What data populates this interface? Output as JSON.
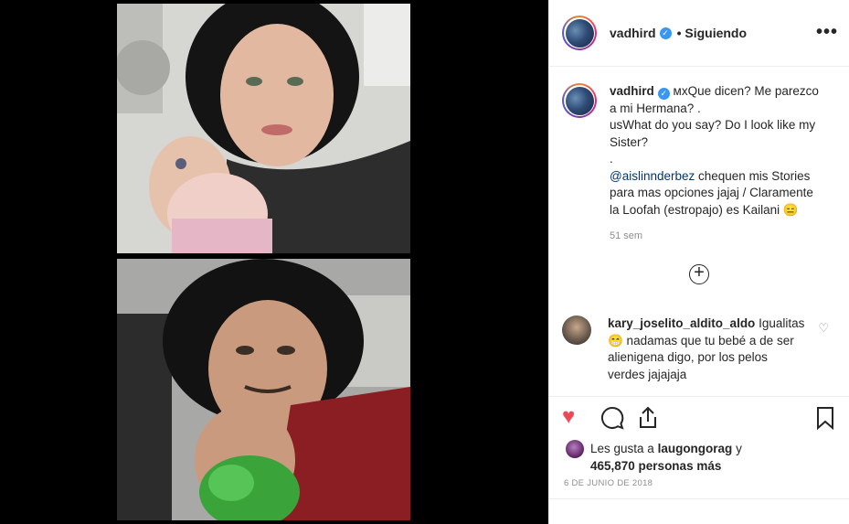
{
  "post": {
    "username": "vadhird",
    "follow_status": "Siguiendo",
    "more_label": "•••",
    "verified_glyph": "✓"
  },
  "caption": {
    "username": "vadhird",
    "lines": [
      "ᴍxQue dicen? Me parezco a mi Hermana? .",
      "usWhat do you say? Do I look like my Sister?",
      "."
    ],
    "mention": "@aislinnderbez",
    "rest": " chequen mis Stories para mas opciones jajaj / Claramente la Loofah (estropajo) es Kailani 😑",
    "time": "51 sem"
  },
  "add_comment_label": "+",
  "comment": {
    "username": "kary_joselito_aldito_aldo",
    "text": " Igualitas 😁 nadamas que tu bebé a de ser alienigena digo, por los pelos verdes jajajaja"
  },
  "actions": {
    "like_icon": "heart-icon",
    "comment_icon": "comment-icon",
    "share_icon": "share-icon",
    "save_icon": "bookmark-icon",
    "like_color": "#ed4956"
  },
  "likes": {
    "prefix": "Les gusta a ",
    "user": "laugongorag",
    "middle": " y ",
    "count": "465,870 personas más"
  },
  "date": "6 DE JUNIO DE 2018"
}
